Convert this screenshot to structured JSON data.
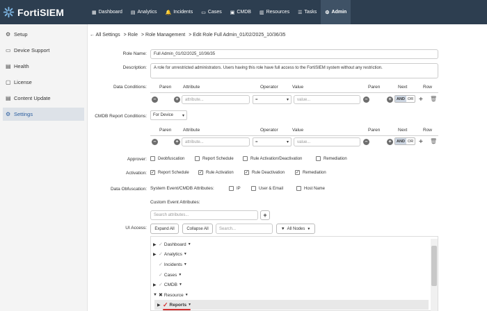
{
  "app": {
    "name": "FortiSIEM"
  },
  "nav": [
    {
      "icon": "dashboard-icon",
      "glyph": "▦",
      "label": "Dashboard",
      "active": false
    },
    {
      "icon": "analytics-icon",
      "glyph": "▤",
      "label": "Analytics",
      "active": false
    },
    {
      "icon": "incidents-icon",
      "glyph": "🔔",
      "label": "Incidents",
      "active": false
    },
    {
      "icon": "cases-icon",
      "glyph": "▭",
      "label": "Cases",
      "active": false
    },
    {
      "icon": "cmdb-icon",
      "glyph": "▣",
      "label": "CMDB",
      "active": false
    },
    {
      "icon": "resources-icon",
      "glyph": "▥",
      "label": "Resources",
      "active": false
    },
    {
      "icon": "tasks-icon",
      "glyph": "☰",
      "label": "Tasks",
      "active": false
    },
    {
      "icon": "admin-gears-icon",
      "glyph": "⚙",
      "label": "Admin",
      "active": true
    }
  ],
  "sidebar": [
    {
      "icon": "gear-icon",
      "glyph": "⚙",
      "label": "Setup",
      "active": false
    },
    {
      "icon": "device-icon",
      "glyph": "▭",
      "label": "Device Support",
      "active": false
    },
    {
      "icon": "health-icon",
      "glyph": "▤",
      "label": "Health",
      "active": false
    },
    {
      "icon": "license-icon",
      "glyph": "▢",
      "label": "License",
      "active": false
    },
    {
      "icon": "content-update-icon",
      "glyph": "▤",
      "label": "Content Update",
      "active": false
    },
    {
      "icon": "settings-gears-icon",
      "glyph": "⚙",
      "label": "Settings",
      "active": true
    }
  ],
  "breadcrumb": {
    "back": "← All Settings",
    "items": [
      "> Role",
      "> Role Management",
      "> Edit Role Full Admin_01/02/2025_10/36/35"
    ]
  },
  "form": {
    "role_name_label": "Role Name:",
    "role_name_value": "Full Admin_01/02/2025_10/36/35",
    "description_label": "Description:",
    "description_value": "A role for unrestricted administrators. Users having this role have full access to the FortiSIEM system without any restriction.",
    "data_conditions_label": "Data Conditions:",
    "cmdb_conditions_label": "CMDB Report Conditions:",
    "cmdb_for_device": "For  Device",
    "approver_label": "Approver:",
    "activation_label": "Activation:",
    "obfuscation_label": "Data Obfuscation:",
    "ui_access_label": "UI Access:"
  },
  "conditions_table": {
    "headers": {
      "paren": "Paren",
      "attribute": "Attribute",
      "operator": "Operator",
      "value": "Value",
      "paren2": "Paren",
      "next": "Next",
      "row": "Row"
    },
    "attribute_placeholder": "attribute...",
    "value_placeholder": "value...",
    "data_operator": "=",
    "cmdb_operator": "=",
    "and_label": "AND",
    "or_label": "OR"
  },
  "approver": [
    {
      "label": "Deobfuscation",
      "checked": false
    },
    {
      "label": "Report Schedule",
      "checked": false
    },
    {
      "label": "Rule Activation/Deactivation",
      "checked": false
    },
    {
      "label": "Remediation",
      "checked": false
    }
  ],
  "activation": [
    {
      "label": "Report Schedule",
      "checked": true
    },
    {
      "label": "Rule Activation",
      "checked": true
    },
    {
      "label": "Rule Deactivation",
      "checked": true
    },
    {
      "label": "Remediation",
      "checked": true
    }
  ],
  "obfuscation": {
    "system_label": "System Event/CMDB Attributes:",
    "options": [
      {
        "label": "IP",
        "checked": false
      },
      {
        "label": "User & Email",
        "checked": false
      },
      {
        "label": "Host Name",
        "checked": false
      }
    ],
    "custom_label": "Custom Event Attributes:",
    "search_placeholder": "Search attributes..."
  },
  "ui_access": {
    "expand_all": "Expand All",
    "collapse_all": "Collapse All",
    "search_placeholder": "Search...",
    "filter_label": "All Nodes",
    "tree": [
      {
        "label": "Dashboard",
        "expander": "▶",
        "mark": "✓"
      },
      {
        "label": "Analytics",
        "expander": "▶",
        "mark": "✓"
      },
      {
        "label": "Incidents",
        "expander": "",
        "mark": "✓"
      },
      {
        "label": "Cases",
        "expander": "",
        "mark": "✓"
      },
      {
        "label": "CMDB",
        "expander": "▶",
        "mark": "✓"
      },
      {
        "label": "Resource",
        "expander": "▼",
        "mark": "✖"
      },
      {
        "label": "Reports",
        "expander": "▶",
        "mark": "✓"
      }
    ]
  },
  "colors": {
    "topbar": "#2d3e50",
    "accent": "#2a5d9f",
    "highlight_mark": "#d32f2f"
  }
}
